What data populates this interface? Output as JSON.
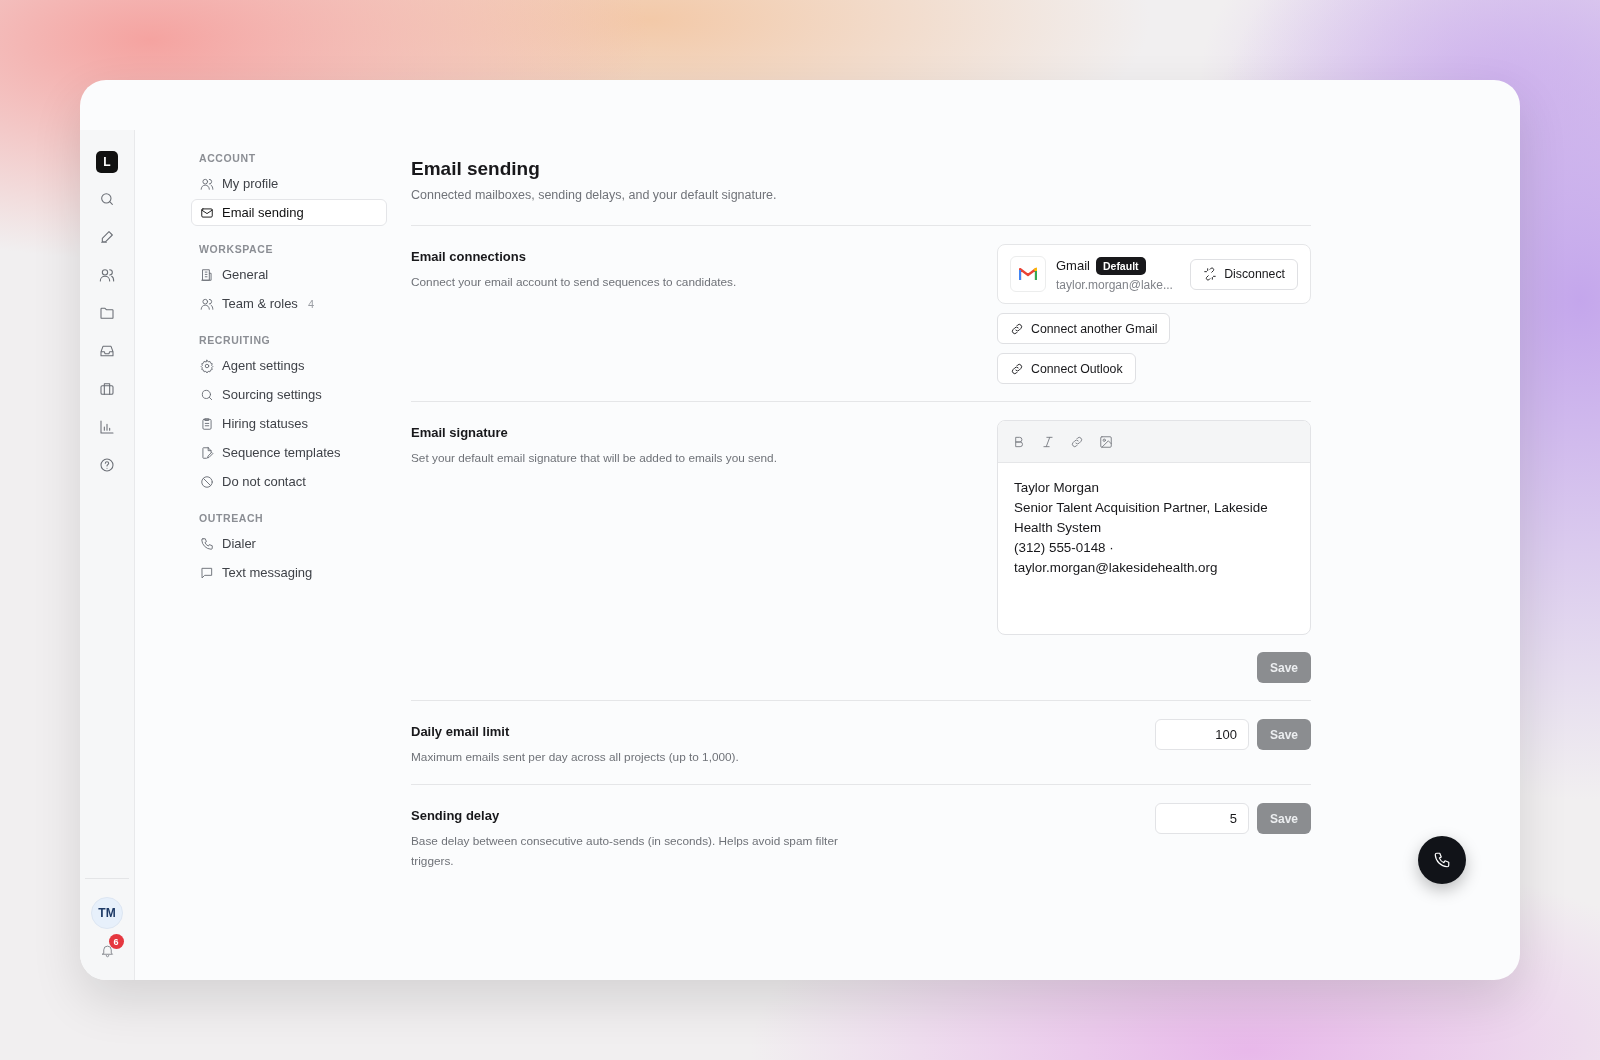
{
  "rail": {
    "logo": "L",
    "avatar": "TM",
    "notification_count": "6"
  },
  "nav": [
    {
      "heading": "ACCOUNT",
      "items": [
        {
          "label": "My profile",
          "selected": false
        },
        {
          "label": "Email sending",
          "selected": true
        }
      ]
    },
    {
      "heading": "WORKSPACE",
      "items": [
        {
          "label": "General",
          "selected": false
        },
        {
          "label": "Team & roles",
          "count": "4",
          "selected": false
        }
      ]
    },
    {
      "heading": "RECRUITING",
      "items": [
        {
          "label": "Agent settings",
          "selected": false
        },
        {
          "label": "Sourcing settings",
          "selected": false
        },
        {
          "label": "Hiring statuses",
          "selected": false
        },
        {
          "label": "Sequence templates",
          "selected": false
        },
        {
          "label": "Do not contact",
          "selected": false
        }
      ]
    },
    {
      "heading": "OUTREACH",
      "items": [
        {
          "label": "Dialer",
          "selected": false
        },
        {
          "label": "Text messaging",
          "selected": false
        }
      ]
    }
  ],
  "page": {
    "title": "Email sending",
    "subtitle": "Connected mailboxes, sending delays, and your default signature."
  },
  "sections": [
    {
      "kind": "connections",
      "title": "Email connections",
      "description": "Connect your email account to send sequences to candidates.",
      "account": {
        "provider": "Gmail",
        "badge": "Default",
        "email": "taylor.morgan@lake...",
        "button": "Disconnect"
      },
      "buttons": [
        "Connect another Gmail",
        "Connect Outlook"
      ]
    },
    {
      "kind": "signature",
      "title": "Email signature",
      "description": "Set your default email signature that will be added to emails you send.",
      "lines": [
        "Taylor Morgan",
        "Senior Talent Acquisition Partner, Lakeside Health System",
        "(312) 555-0148 · taylor.morgan@lakesidehealth.org"
      ],
      "button": "Save",
      "disabled": true
    },
    {
      "kind": "number",
      "title": "Daily email limit",
      "description": "Maximum emails sent per day across all projects (up to 1,000).",
      "value": "100",
      "button": "Save",
      "disabled": true
    },
    {
      "kind": "number",
      "title": "Sending delay",
      "description": "Base delay between consecutive auto-sends (in seconds). Helps avoid spam filter triggers.",
      "value": "5",
      "button": "Save",
      "disabled": true
    }
  ]
}
